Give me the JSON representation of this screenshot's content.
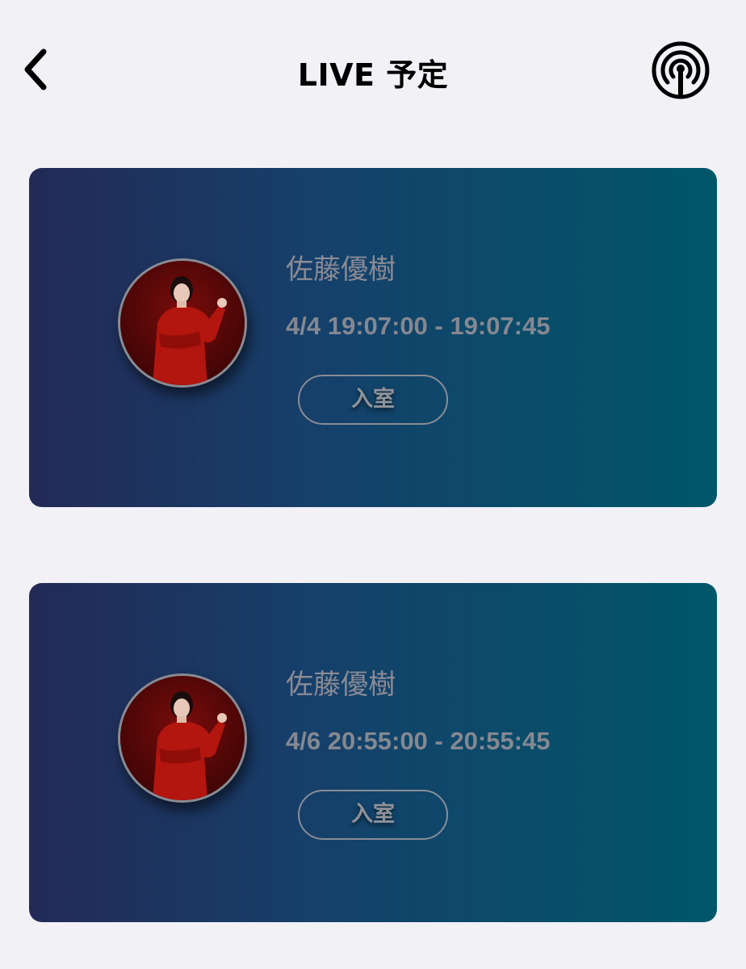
{
  "header": {
    "title": "LIVE 予定",
    "back_icon": "chevron-left-icon",
    "broadcast_icon": "broadcast-antenna-icon"
  },
  "lives": [
    {
      "name": "佐藤優樹",
      "time": "4/4 19:07:00 - 19:07:45",
      "enter_label": "入室"
    },
    {
      "name": "佐藤優樹",
      "time": "4/6 20:55:00 - 20:55:45",
      "enter_label": "入室"
    }
  ],
  "colors": {
    "background": "#f2f1f6",
    "card_gradient_start": "#232a56",
    "card_gradient_end": "#005769",
    "muted_text": "#8a8a94"
  }
}
